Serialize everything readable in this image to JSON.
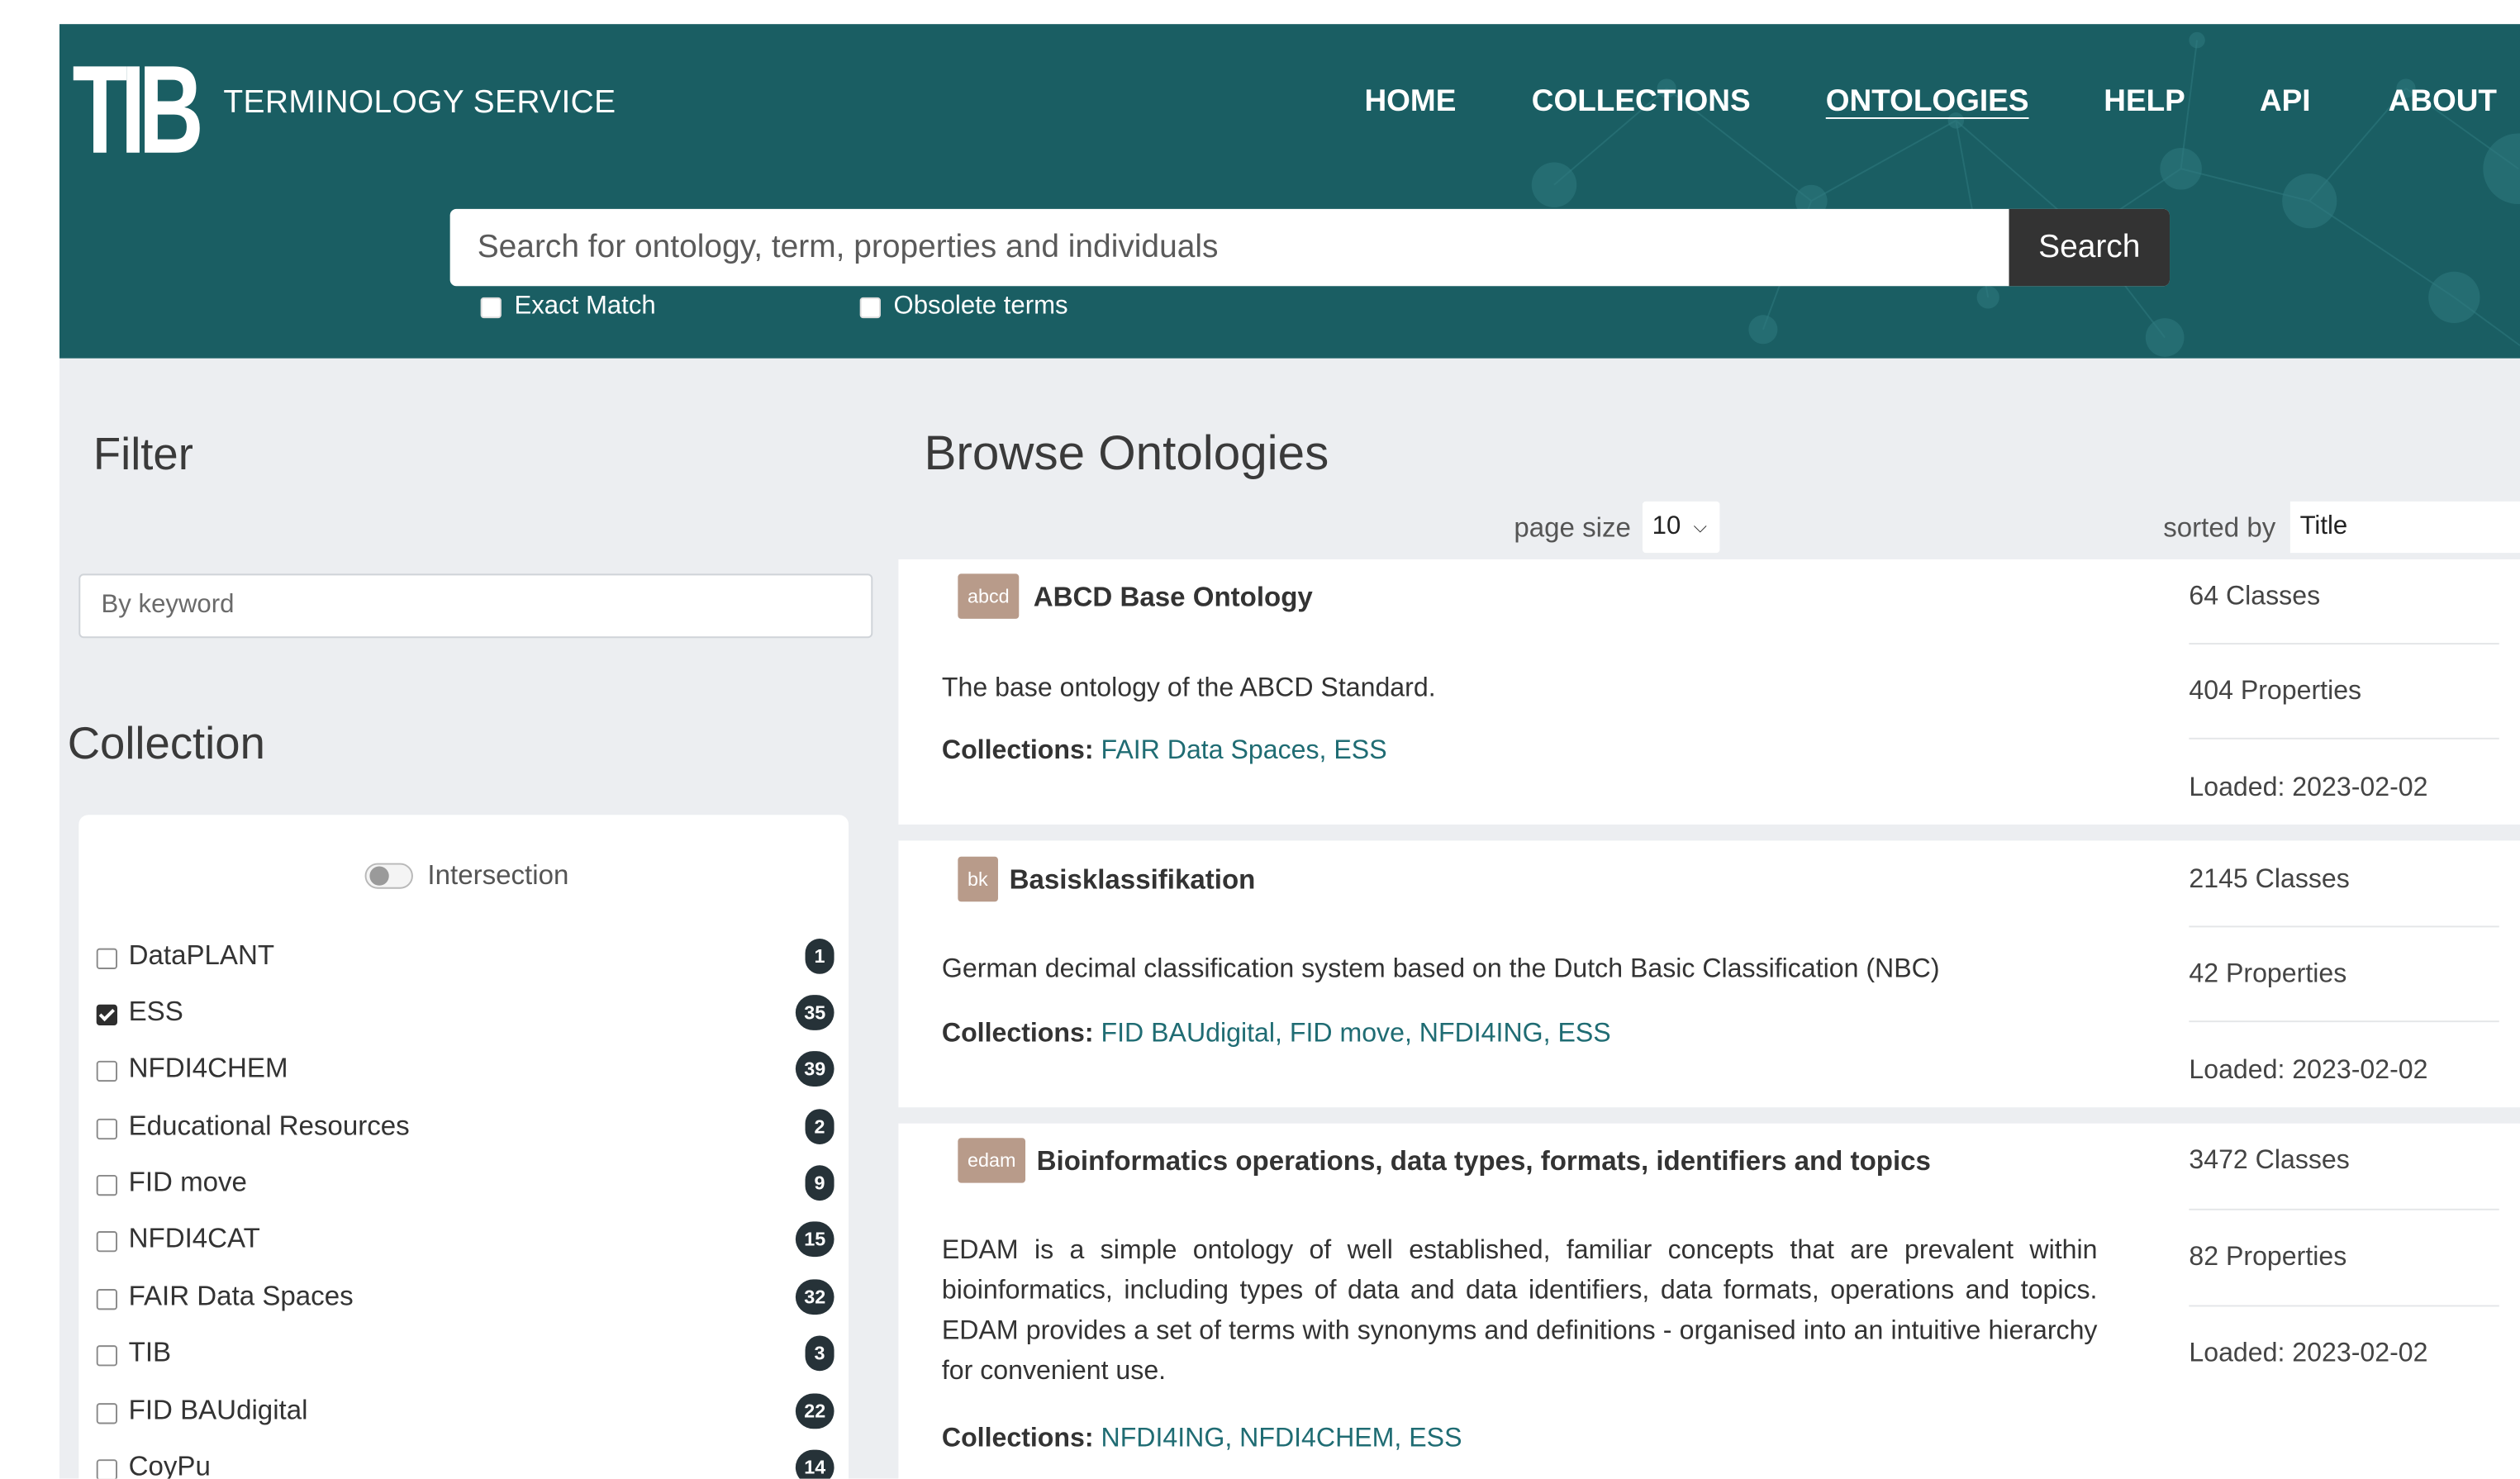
{
  "header": {
    "logo": "TIB",
    "service_name": "TERMINOLOGY SERVICE",
    "nav": [
      {
        "label": "HOME",
        "active": false
      },
      {
        "label": "COLLECTIONS",
        "active": false
      },
      {
        "label": "ONTOLOGIES",
        "active": true
      },
      {
        "label": "HELP",
        "active": false
      },
      {
        "label": "API",
        "active": false
      },
      {
        "label": "ABOUT",
        "active": false
      }
    ],
    "search": {
      "placeholder": "Search for ontology, term, properties and individuals",
      "value": "",
      "button_label": "Search"
    },
    "options": {
      "exact_match": "Exact Match",
      "obsolete_terms": "Obsolete terms"
    }
  },
  "filter": {
    "title": "Filter",
    "keyword_placeholder": "By keyword",
    "collection_title": "Collection",
    "intersection_label": "Intersection",
    "collections": [
      {
        "name": "DataPLANT",
        "count": "1",
        "checked": false
      },
      {
        "name": "ESS",
        "count": "35",
        "checked": true
      },
      {
        "name": "NFDI4CHEM",
        "count": "39",
        "checked": false
      },
      {
        "name": "Educational Resources",
        "count": "2",
        "checked": false
      },
      {
        "name": "FID move",
        "count": "9",
        "checked": false
      },
      {
        "name": "NFDI4CAT",
        "count": "15",
        "checked": false
      },
      {
        "name": "FAIR Data Spaces",
        "count": "32",
        "checked": false
      },
      {
        "name": "TIB",
        "count": "3",
        "checked": false
      },
      {
        "name": "FID BAUdigital",
        "count": "22",
        "checked": false
      },
      {
        "name": "CoyPu",
        "count": "14",
        "checked": false
      }
    ]
  },
  "browse": {
    "title": "Browse Ontologies",
    "page_size_label": "page size",
    "page_size_value": "10",
    "sorted_by_label": "sorted by",
    "sorted_by_value": "Title",
    "collections_label": "Collections:",
    "ontologies": [
      {
        "abbr": "abcd",
        "title": "ABCD Base Ontology",
        "description": "The base ontology of the ABCD Standard.",
        "collections": [
          "FAIR Data Spaces",
          "ESS"
        ],
        "classes": "64 Classes",
        "properties": "404 Properties",
        "loaded": "Loaded: 2023-02-02"
      },
      {
        "abbr": "bk",
        "title": "Basisklassifikation",
        "description": "German decimal classification system based on the Dutch Basic Classification (NBC)",
        "collections": [
          "FID BAUdigital",
          "FID move",
          "NFDI4ING",
          "ESS"
        ],
        "classes": "2145 Classes",
        "properties": "42 Properties",
        "loaded": "Loaded: 2023-02-02"
      },
      {
        "abbr": "edam",
        "title": "Bioinformatics operations, data types, formats, identifiers and topics",
        "description": "EDAM is a simple ontology of well established, familiar concepts that are prevalent within bioinformatics, including types of data and data identifiers, data formats, operations and topics. EDAM provides a set of terms with synonyms and definitions - organised into an intuitive hierarchy for convenient use.",
        "collections": [
          "NFDI4ING",
          "NFDI4CHEM",
          "ESS"
        ],
        "classes": "3472 Classes",
        "properties": "82 Properties",
        "loaded": "Loaded: 2023-02-02"
      }
    ]
  }
}
